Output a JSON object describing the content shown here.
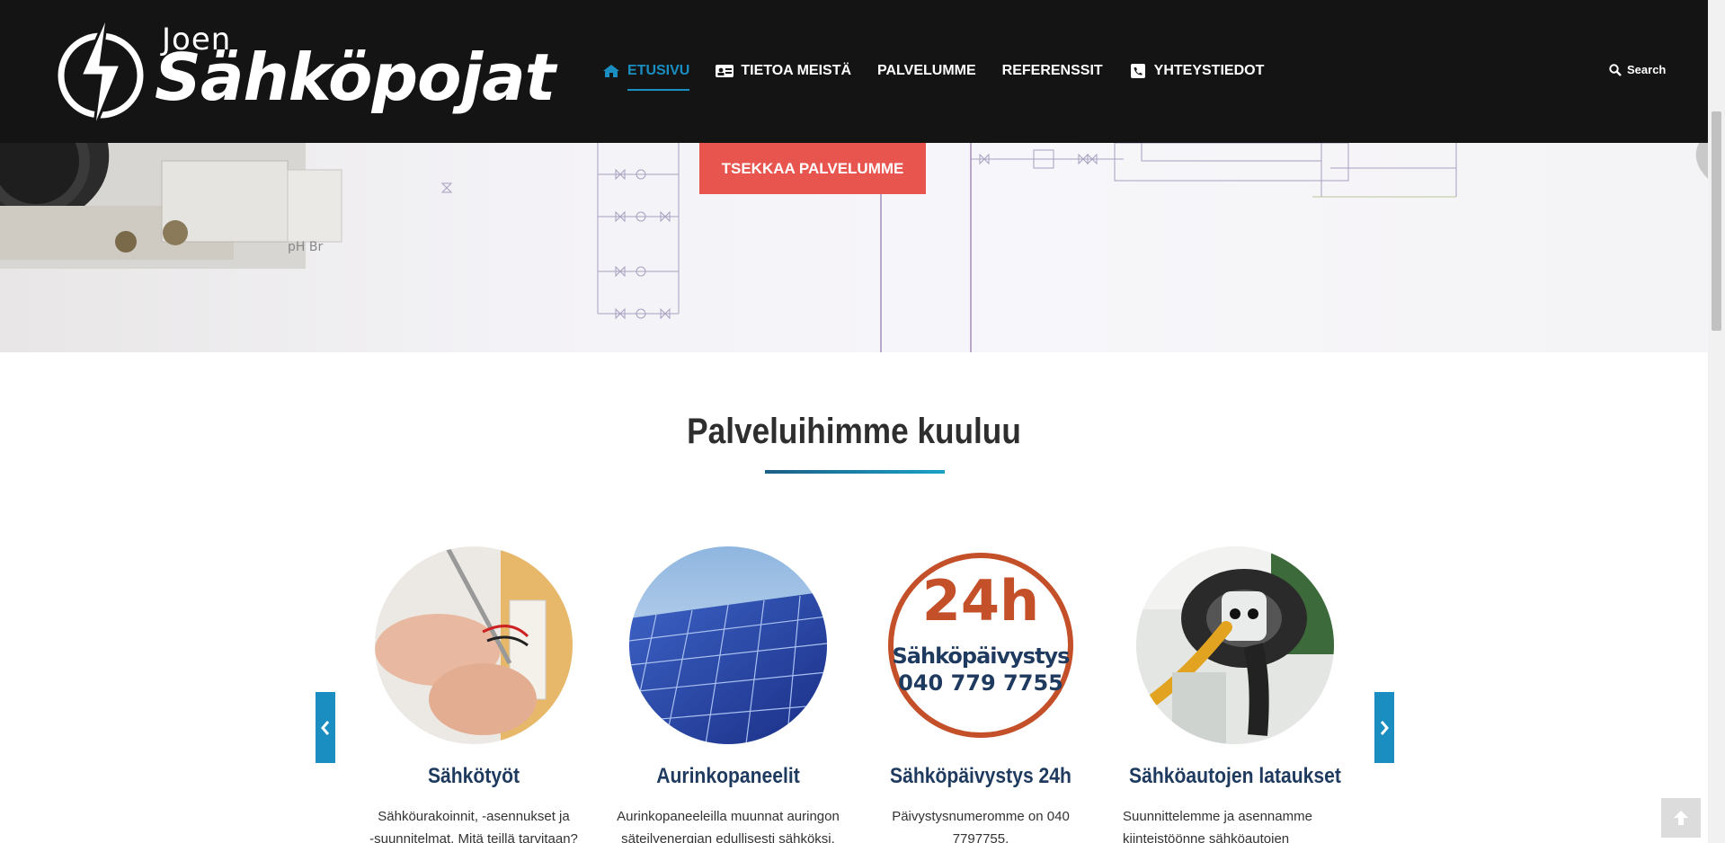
{
  "header": {
    "logo_small": "Joen",
    "logo_large": "Sähköpojat",
    "nav": [
      {
        "label": "ETUSIVU",
        "icon": "home-icon",
        "active": true
      },
      {
        "label": "TIETOA MEISTÄ",
        "icon": "id-card-icon",
        "active": false
      },
      {
        "label": "PALVELUMME",
        "icon": "",
        "active": false
      },
      {
        "label": "REFERENSSIT",
        "icon": "",
        "active": false
      },
      {
        "label": "YHTEYSTIEDOT",
        "icon": "phone-square-icon",
        "active": false
      }
    ],
    "search_label": "Search"
  },
  "hero": {
    "cta_label": "TSEKKAA PALVELUMME"
  },
  "services": {
    "title": "Palveluihimme kuuluu",
    "cards": [
      {
        "title": "Sähkötyöt",
        "text_line1": "Sähköurakoinnit, -asennukset ja",
        "text_line2": "-suunnitelmat. Mitä teillä tarvitaan?"
      },
      {
        "title": "Aurinkopaneelit",
        "text_line1": "Aurinkopaneeleilla muunnat auringon",
        "text_line2": "säteilyenergian edullisesti sähköksi."
      },
      {
        "title": "Sähköpäivystys 24h",
        "text_line1": "Päivystysnumeromme on 040",
        "text_line2": "7797755.",
        "badge_top": "24h",
        "badge_mid": "Sähköpäivystys",
        "badge_phone": "040 779 7755"
      },
      {
        "title": "Sähköautojen lataukset",
        "text_line1": "Suunnittelemme ja asennamme",
        "text_line2": "kiinteistöönne sähköautojen"
      }
    ]
  },
  "colors": {
    "header_bg": "#141414",
    "accent": "#1a8ec0",
    "cta": "#e8554e",
    "card_title": "#1f3a5f",
    "badge": "#c4502a",
    "badge_text": "#1f3a5f"
  }
}
